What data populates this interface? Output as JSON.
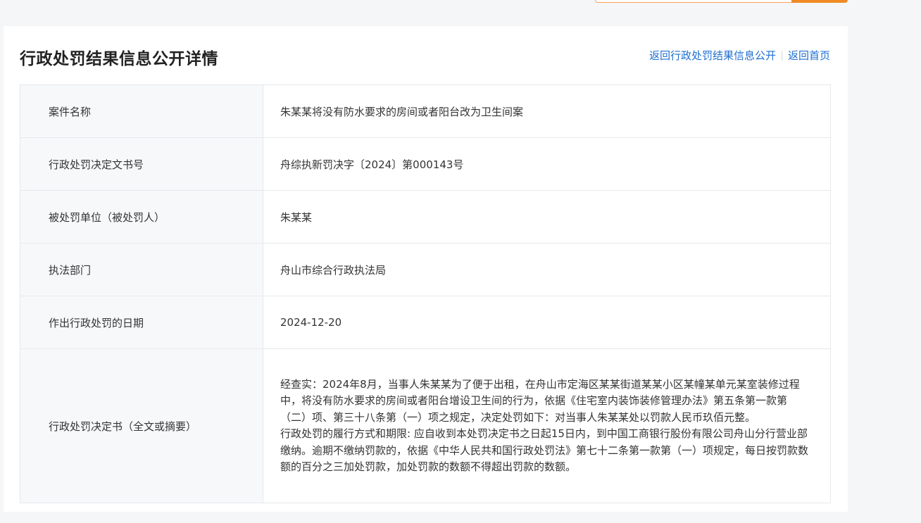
{
  "page": {
    "title": "行政处罚结果信息公开详情",
    "links": {
      "back_to_list": "返回行政处罚结果信息公开",
      "home": "返回首页"
    }
  },
  "record": {
    "rows": [
      {
        "label": "案件名称",
        "value": "朱某某将没有防水要求的房间或者阳台改为卫生间案"
      },
      {
        "label": "行政处罚决定文书号",
        "value": "舟综执新罚决字〔2024〕第000143号"
      },
      {
        "label": "被处罚单位（被处罚人）",
        "value": "朱某某"
      },
      {
        "label": "执法部门",
        "value": "舟山市综合行政执法局"
      },
      {
        "label": "作出行政处罚的日期",
        "value": "2024-12-20"
      }
    ],
    "decision": {
      "label": "行政处罚决定书（全文或摘要）",
      "paragraph1": "经查实：2024年8月，当事人朱某某为了便于出租，在舟山市定海区某某街道某某小区某幢某单元某室装修过程中，将没有防水要求的房间或者阳台增设卫生间的行为，依据《住宅室内装饰装修管理办法》第五条第一款第（二）项、第三十八条第（一）项之规定，决定处罚如下：对当事人朱某某处以罚款人民币玖佰元整。",
      "paragraph2": "行政处罚的履行方式和期限: 应自收到本处罚决定书之日起15日内，到中国工商银行股份有限公司舟山分行营业部缴纳。逾期不缴纳罚款的，依据《中华人民共和国行政处罚法》第七十二条第一款第（一）项规定，每日按罚款数额的百分之三加处罚款，加处罚款的数额不得超出罚款的数额。"
    }
  },
  "watermark": " "
}
